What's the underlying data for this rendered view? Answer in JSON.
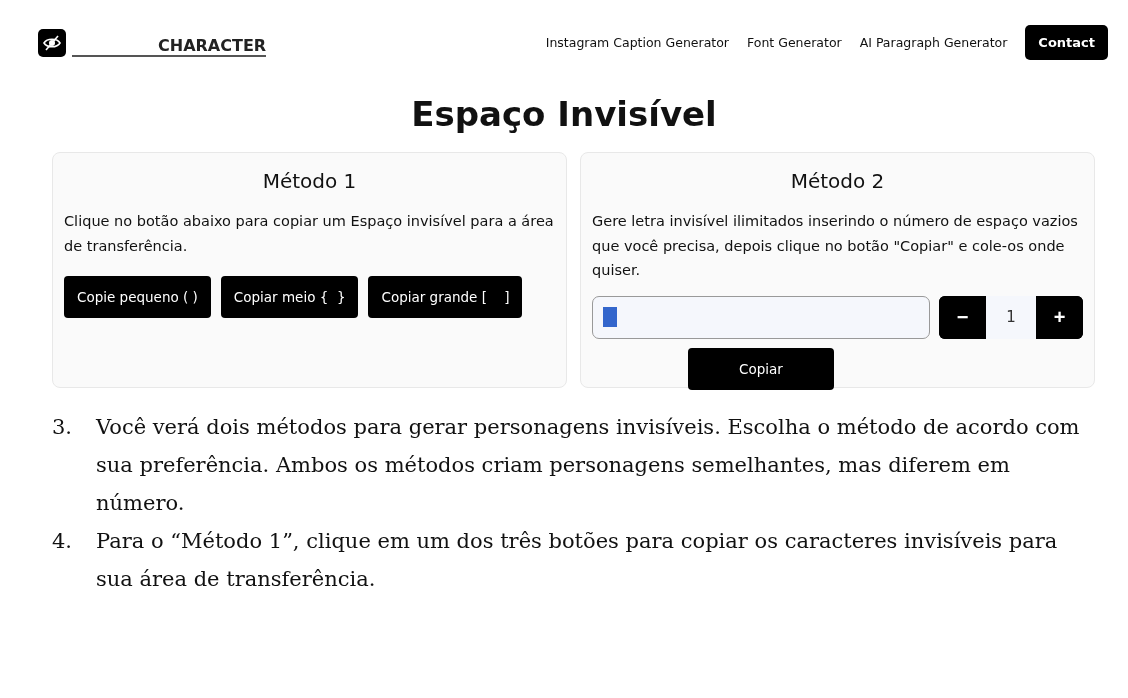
{
  "header": {
    "logo_text": "CHARACTER",
    "nav": [
      "Instagram Caption Generator",
      "Font Generator",
      "AI Paragraph Generator"
    ],
    "contact_button": "Contact"
  },
  "title": "Espaço Invisível",
  "method1": {
    "heading": "Método 1",
    "description": "Clique no botão abaixo para copiar um Espaço invisível para a área de transferência.",
    "buttons": [
      "Copie pequeno ( )",
      "Copiar meio {  }",
      "Copiar grande [    ]"
    ]
  },
  "method2": {
    "heading": "Método 2",
    "description": "Gere letra invisível ilimitados inserindo o número de espaço vazios que você precisa, depois clique no botão \"Copiar\" e cole-os onde quiser.",
    "stepper": {
      "minus": "−",
      "value": "1",
      "plus": "+"
    },
    "copy_button": "Copiar"
  },
  "steps": [
    {
      "number": "3.",
      "text": "Você verá dois métodos para gerar personagens invisíveis. Escolha o método de acordo com sua preferência. Ambos os métodos criam personagens semelhantes, mas diferem em número."
    },
    {
      "number": "4.",
      "text": "Para o “Método 1”, clique em um dos três botões para copiar os caracteres invisíveis para sua área de transferência."
    }
  ]
}
